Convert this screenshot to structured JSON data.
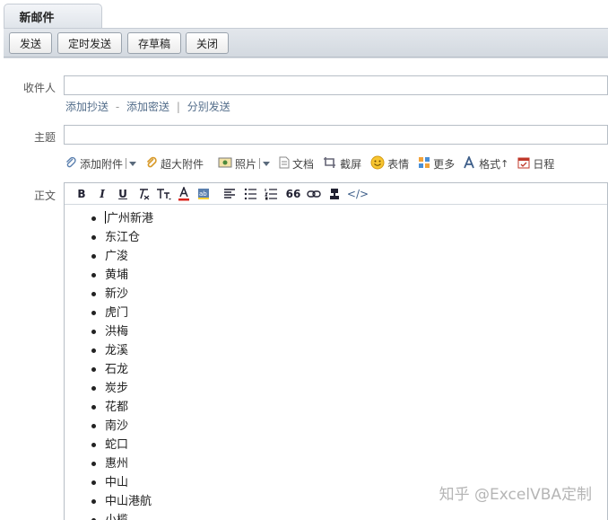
{
  "tab": {
    "title": "新邮件"
  },
  "toolbar": {
    "send": "发送",
    "scheduled_send": "定时发送",
    "save_draft": "存草稿",
    "close": "关闭"
  },
  "form": {
    "recipient_label": "收件人",
    "recipient_value": "",
    "add_cc": "添加抄送",
    "add_bcc": "添加密送",
    "separate_send": "分别发送",
    "subject_label": "主题",
    "subject_value": "",
    "body_label": "正文"
  },
  "attachments": {
    "add_attachment": "添加附件",
    "large_attachment": "超大附件",
    "photo": "照片",
    "document": "文档",
    "screenshot": "截屏",
    "emoji": "表情",
    "more": "更多",
    "format": "格式",
    "calendar": "日程"
  },
  "format_toolbar": {
    "bold": "B",
    "italic": "I",
    "underline": "U",
    "quote": "66",
    "html": "</>"
  },
  "body_items": [
    "广州新港",
    "东江仓",
    "广浚",
    "黄埔",
    "新沙",
    "虎门",
    "洪梅",
    "龙溪",
    "石龙",
    "炭步",
    "花都",
    "南沙",
    "蛇口",
    "惠州",
    "中山",
    "中山港航",
    "小榄"
  ],
  "watermark": "知乎 @ExcelVBA定制",
  "colors": {
    "accent": "#536d8a",
    "toolbar_bg": "#d3d9e0"
  }
}
